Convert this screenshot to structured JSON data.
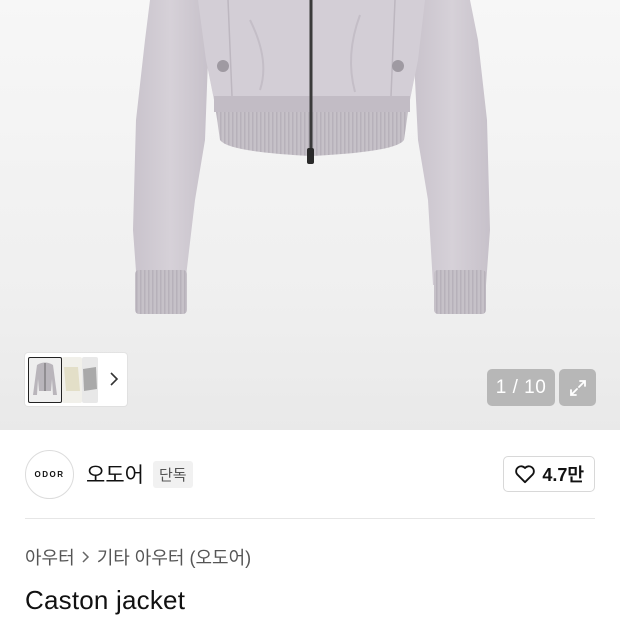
{
  "gallery": {
    "counter": "1 / 10",
    "expand_icon": "expand-icon",
    "next_thumbs_icon": "chevron-right-icon"
  },
  "brand": {
    "logo_text": "ODOR",
    "name": "오도어",
    "badge": "단독"
  },
  "like": {
    "icon": "heart-icon",
    "count": "4.7만"
  },
  "breadcrumb": {
    "items": [
      "아우터",
      "기타 아우터 (오도어)"
    ],
    "separator_icon": "chevron-right-icon"
  },
  "product": {
    "title": "Caston jacket"
  },
  "colors": {
    "jacket": "#cfc9d1",
    "overlay": "#8c8c8c"
  }
}
